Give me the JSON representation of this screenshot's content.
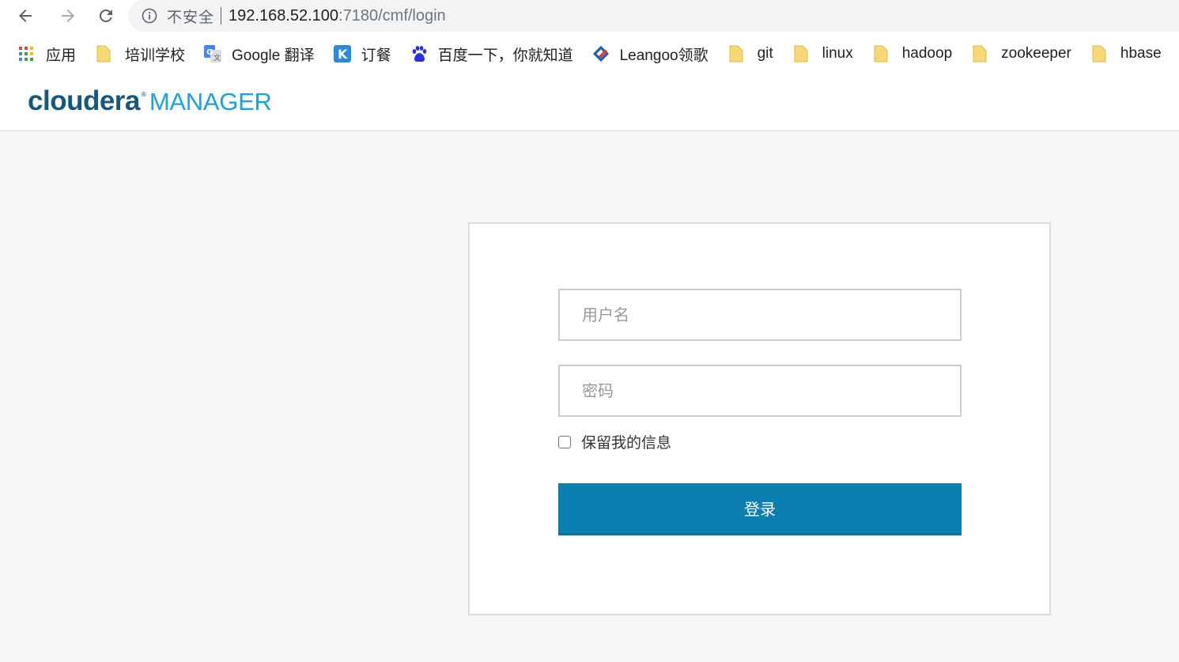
{
  "browser": {
    "security_label": "不安全",
    "url_host": "192.168.52.100",
    "url_path": ":7180/cmf/login"
  },
  "bookmarks": {
    "apps": "应用",
    "items": [
      {
        "label": "培训学校",
        "icon": "folder-icon"
      },
      {
        "label": "Google 翻译",
        "icon": "google-translate-icon"
      },
      {
        "label": "订餐",
        "icon": "k-app-icon"
      },
      {
        "label": "百度一下，你就知道",
        "icon": "baidu-paw-icon"
      },
      {
        "label": "Leangoo领歌",
        "icon": "leangoo-icon"
      },
      {
        "label": "git",
        "icon": "folder-icon"
      },
      {
        "label": "linux",
        "icon": "folder-icon"
      },
      {
        "label": "hadoop",
        "icon": "folder-icon"
      },
      {
        "label": "zookeeper",
        "icon": "folder-icon"
      },
      {
        "label": "hbase",
        "icon": "folder-icon"
      }
    ]
  },
  "header": {
    "brand": "cloudera",
    "reg": "®",
    "product": "MANAGER"
  },
  "login": {
    "username_placeholder": "用户名",
    "password_placeholder": "密码",
    "remember_label": "保留我的信息",
    "remember_checked": false,
    "submit_label": "登录"
  },
  "colors": {
    "brand_dark": "#15587d",
    "brand_light": "#1aa3dc",
    "button": "#0b7fb0",
    "folder": "#f8d775"
  }
}
